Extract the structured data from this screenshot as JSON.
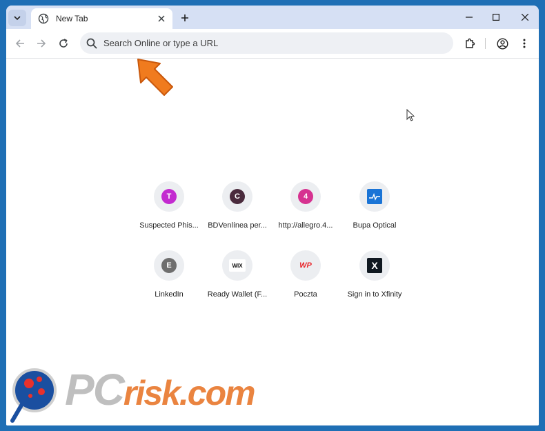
{
  "tab": {
    "title": "New Tab"
  },
  "omnibox": {
    "placeholder": "Search Online or type a URL"
  },
  "shortcuts": [
    {
      "label": "Suspected Phis...",
      "glyph": "T",
      "color": "#c32ad0"
    },
    {
      "label": "BDVenlínea per...",
      "glyph": "C",
      "color": "#4a2b3d"
    },
    {
      "label": "http://allegro.4...",
      "glyph": "4",
      "color": "#d63290"
    },
    {
      "label": "Bupa Optical",
      "glyph": "",
      "color": "#1a74d6"
    },
    {
      "label": "LinkedIn",
      "glyph": "E",
      "color": "#6e6e6e"
    },
    {
      "label": "Ready Wallet (F...",
      "glyph": "WIX",
      "color": "#ffffff"
    },
    {
      "label": "Poczta",
      "glyph": "WP",
      "color": "#ffffff"
    },
    {
      "label": "Sign in to Xfinity",
      "glyph": "X",
      "color": "#101820"
    }
  ],
  "watermark": {
    "brand": "PC",
    "suffix": "risk.com"
  },
  "colors": {
    "frame": "#1f6fb5",
    "titlebar": "#d6e0f4",
    "arrow": "#f07b1e"
  }
}
